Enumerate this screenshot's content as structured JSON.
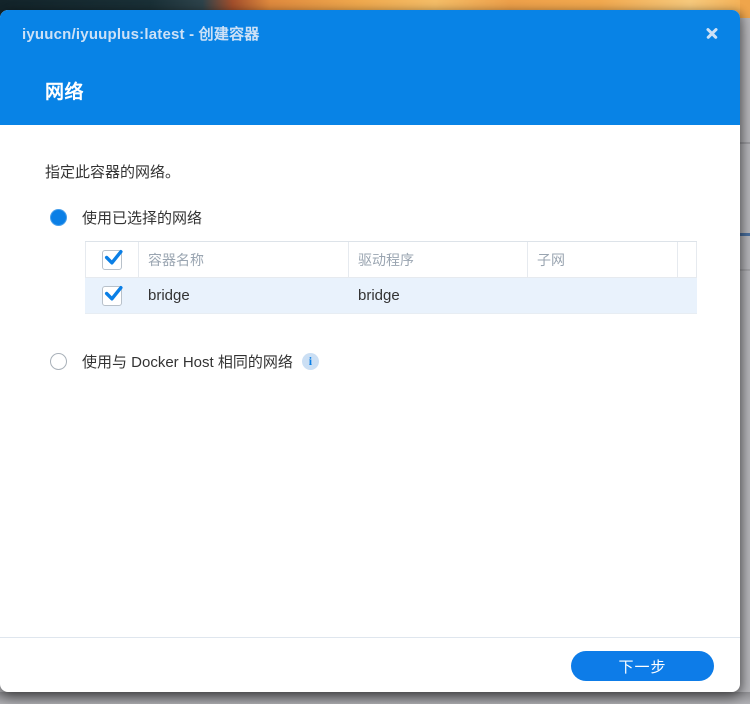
{
  "window": {
    "title": "iyuucn/iyuuplus:latest - 创建容器",
    "section_title": "网络"
  },
  "icons": {
    "close": "x-icon",
    "info": "info-icon",
    "info_glyph": "i"
  },
  "network_step": {
    "instruction": "指定此容器的网络。",
    "options": [
      {
        "label": "使用已选择的网络",
        "selected": true
      },
      {
        "label": "使用与 Docker Host 相同的网络",
        "selected": false,
        "has_info_icon": true
      }
    ],
    "table": {
      "header_checkbox_checked": true,
      "columns": [
        "容器名称",
        "驱动程序",
        "子网"
      ],
      "rows": [
        {
          "checked": true,
          "name": "bridge",
          "driver": "bridge",
          "subnet": ""
        }
      ]
    }
  },
  "footer": {
    "next_label": "下一步"
  },
  "colors": {
    "header_blue": "#0883e6",
    "accent_blue": "#0a7fe6",
    "selected_row_bg": "#e9f2fc",
    "button_blue": "#0d7ce8",
    "title_text": "#cde1f6"
  }
}
